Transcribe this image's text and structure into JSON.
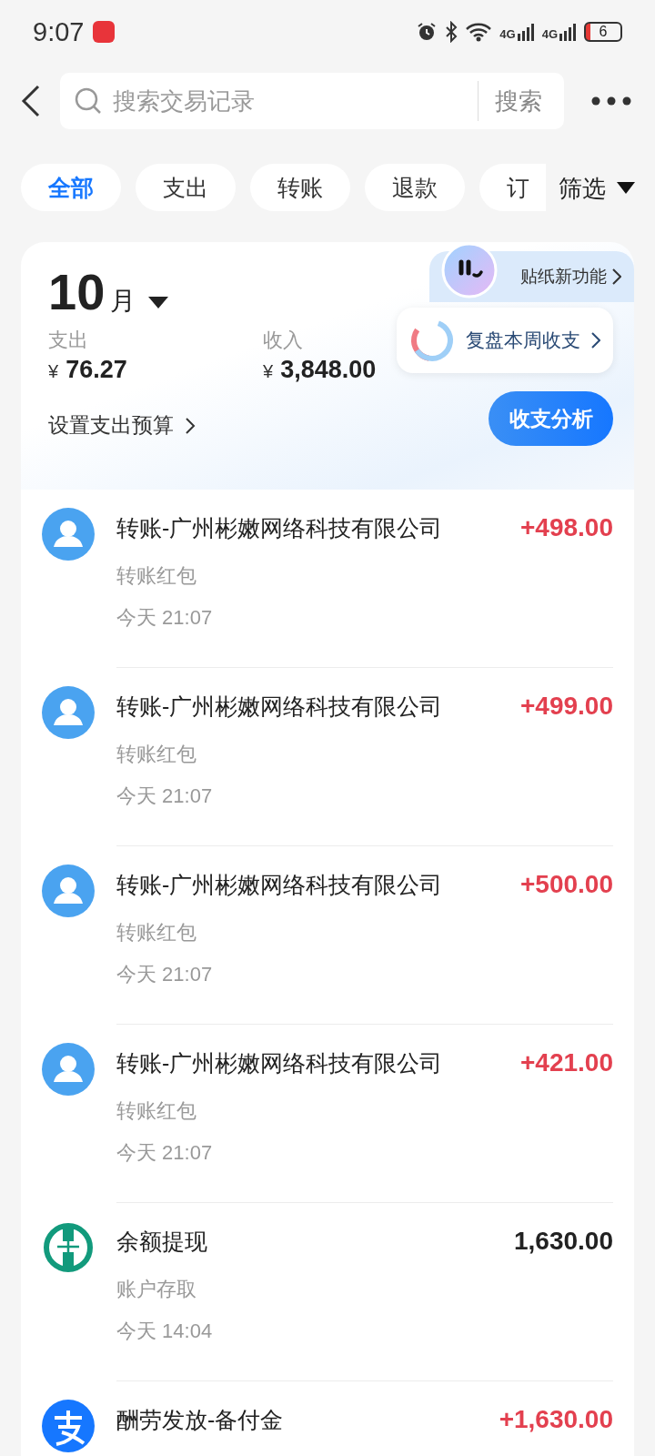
{
  "status_bar": {
    "time": "9:07",
    "battery": "6",
    "network_1": "4G",
    "network_2": "4G"
  },
  "header": {
    "search_placeholder": "搜索交易记录",
    "search_button": "搜索"
  },
  "filters": [
    {
      "label": "全部",
      "selected": true
    },
    {
      "label": "支出",
      "selected": false
    },
    {
      "label": "转账",
      "selected": false
    },
    {
      "label": "退款",
      "selected": false
    },
    {
      "label": "订",
      "selected": false
    }
  ],
  "filter_button": "筛选",
  "summary": {
    "month": "10",
    "month_unit": "月",
    "expense_label": "支出",
    "expense_currency": "¥",
    "expense": "76.27",
    "income_label": "收入",
    "income_currency": "¥",
    "income": "3,848.00",
    "budget_link": "设置支出预算",
    "sticker_tab": "贴纸新功能",
    "review_bubble": "复盘本周收支",
    "analysis_button": "收支分析"
  },
  "transactions": [
    {
      "kind": "person",
      "title": "转账-广州彬嫩网络科技有限公司",
      "amount": "+498.00",
      "income": true,
      "category": "转账红包",
      "time": "今天 21:07"
    },
    {
      "kind": "person",
      "title": "转账-广州彬嫩网络科技有限公司",
      "amount": "+499.00",
      "income": true,
      "category": "转账红包",
      "time": "今天 21:07"
    },
    {
      "kind": "person",
      "title": "转账-广州彬嫩网络科技有限公司",
      "amount": "+500.00",
      "income": true,
      "category": "转账红包",
      "time": "今天 21:07"
    },
    {
      "kind": "person",
      "title": "转账-广州彬嫩网络科技有限公司",
      "amount": "+421.00",
      "income": true,
      "category": "转账红包",
      "time": "今天 21:07"
    },
    {
      "kind": "bank",
      "title": "余额提现",
      "amount": "1,630.00",
      "income": false,
      "category": "账户存取",
      "time": "今天 14:04"
    },
    {
      "kind": "alipay",
      "title": "酬劳发放-备付金",
      "amount": "+1,630.00",
      "income": true
    }
  ]
}
